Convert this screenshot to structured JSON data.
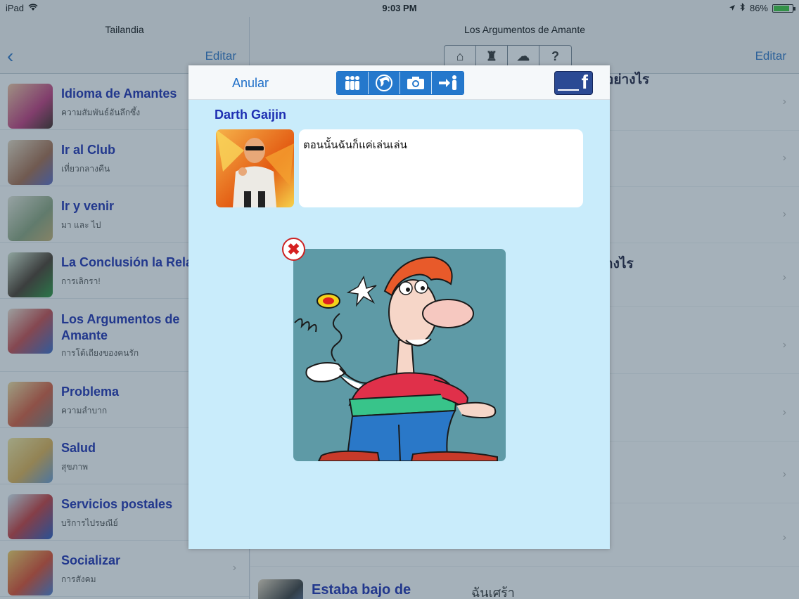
{
  "status_bar": {
    "device": "iPad",
    "time": "9:03 PM",
    "battery": "86%",
    "battery_level": 0.86
  },
  "master": {
    "title": "Tailandia",
    "edit_label": "Editar",
    "items": [
      {
        "title": "Idioma de Amantes",
        "subtitle": "ความสัมพันธ์อันลึกซึ้ง"
      },
      {
        "title": "Ir al Club",
        "subtitle": "เที่ยวกลางคืน"
      },
      {
        "title": "Ir y venir",
        "subtitle": "มา และ ไป"
      },
      {
        "title": "La Conclusión la Rela",
        "subtitle": "การเลิกรา!"
      },
      {
        "title": "Los Argumentos de Amante",
        "subtitle": "การโต้เถียงของคนรัก"
      },
      {
        "title": "Problema",
        "subtitle": "ความลำบาก"
      },
      {
        "title": "Salud",
        "subtitle": "สุขภาพ"
      },
      {
        "title": "Servicios postales",
        "subtitle": "บริการไปรษณีย์"
      },
      {
        "title": "Socializar",
        "subtitle": "การสังคม"
      }
    ]
  },
  "detail": {
    "title": "Los Argumentos de Amante",
    "edit_label": "Editar",
    "bg_text_1": "อย่างไร",
    "bg_text_2": "างไร",
    "bottom_title": "Estaba bajo de",
    "bottom_thai": "ฉันเศร้า"
  },
  "modal": {
    "cancel_label": "Anular",
    "facebook_label": "f",
    "toolbar_icons": [
      "people-icon",
      "globe-icon",
      "camera-icon",
      "share-person-icon"
    ],
    "username": "Darth Gaijin",
    "message": "ตอนนั้นฉันก็แค่เล่นเล่น"
  }
}
